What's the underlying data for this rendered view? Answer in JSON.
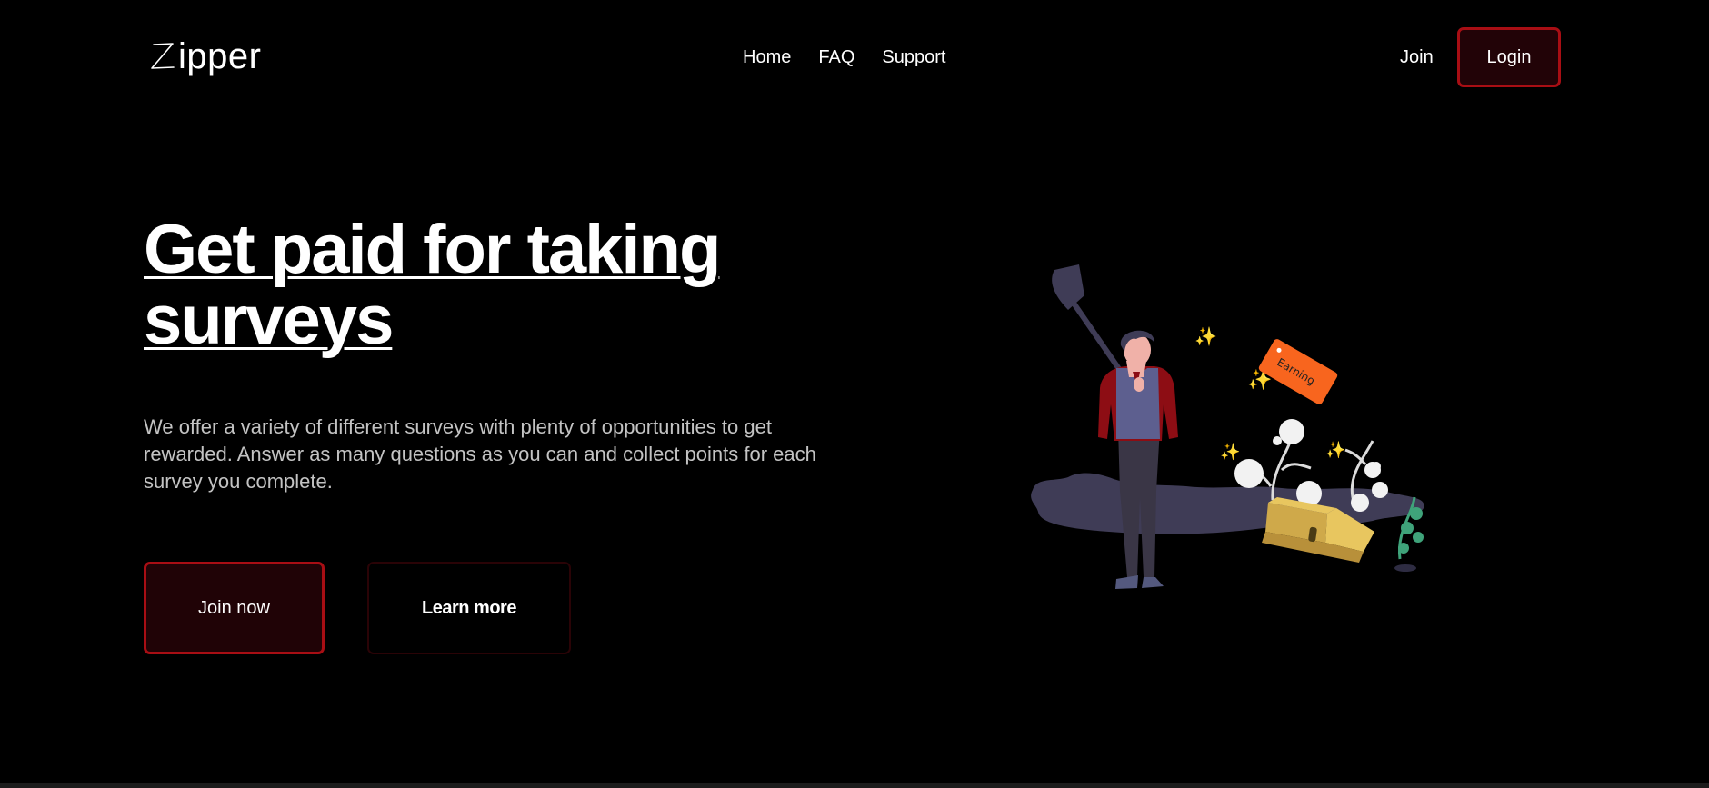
{
  "header": {
    "logo_text": "ipper",
    "nav": [
      "Home",
      "FAQ",
      "Support"
    ],
    "join_label": "Join",
    "login_label": "Login"
  },
  "hero": {
    "title": "Get paid for taking surveys",
    "description": "We offer a variety of different surveys with plenty of opportunities to get rewarded. Answer as many questions as you can and collect points for each survey you complete.",
    "join_now_label": "Join now",
    "learn_more_label": "Learn more"
  },
  "illustration": {
    "tag_text": "Earning"
  },
  "colors": {
    "accent_border": "#a80e14",
    "button_fill": "#220307",
    "ground": "#3f3c56",
    "tag": "#f8651e",
    "chest": "#e8c65f",
    "plant_green": "#3fa37a"
  }
}
